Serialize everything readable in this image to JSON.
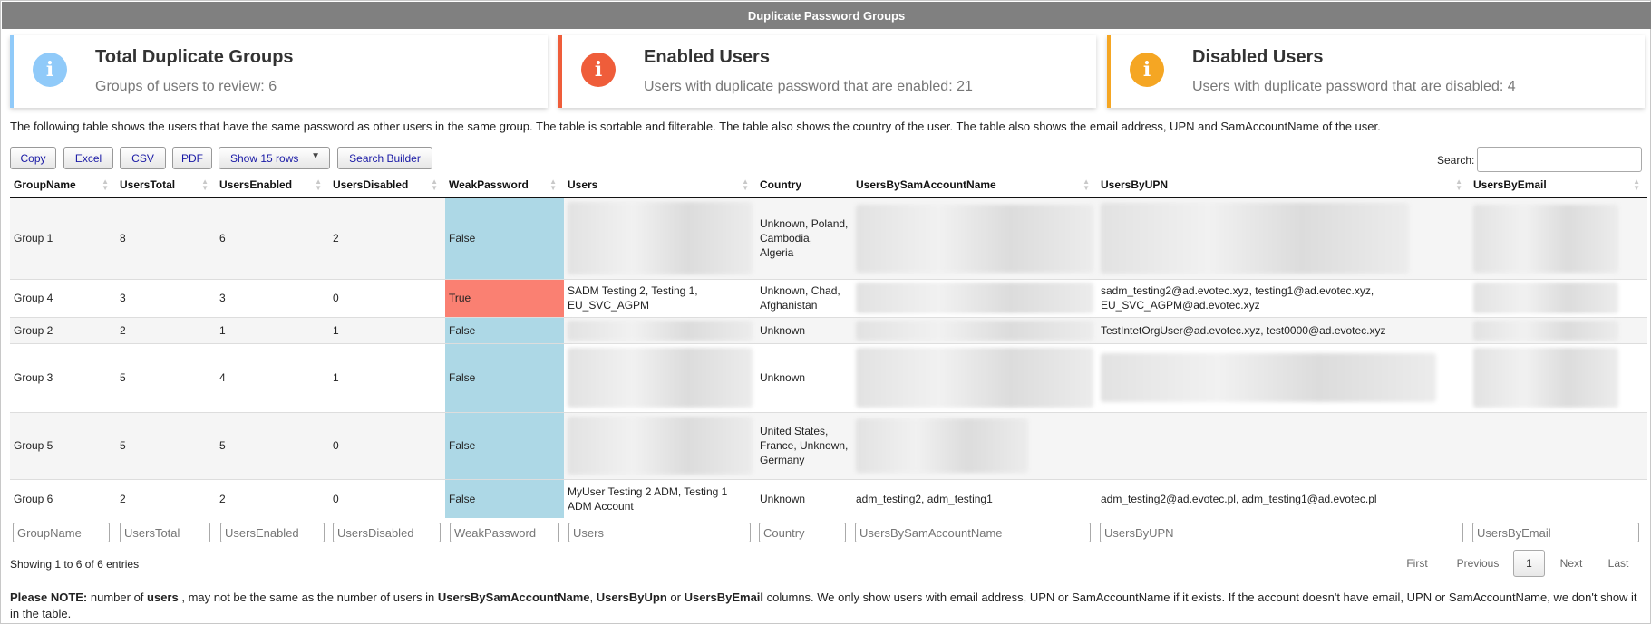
{
  "window": {
    "title": "Duplicate Password Groups"
  },
  "cards": [
    {
      "title": "Total Duplicate Groups",
      "subtitle": "Groups of users to review: 6",
      "icon": "info-icon",
      "color": "#90caf9"
    },
    {
      "title": "Enabled Users",
      "subtitle": "Users with duplicate password that are enabled: 21",
      "icon": "info-icon",
      "color": "#ef5d3a"
    },
    {
      "title": "Disabled Users",
      "subtitle": "Users with duplicate password that are disabled: 4",
      "icon": "info-icon",
      "color": "#f5a623"
    }
  ],
  "description": "The following table shows the users that have the same password as other users in the same group. The table is sortable and filterable. The table also shows the country of the user. The table also shows the email address, UPN and SamAccountName of the user.",
  "toolbar": {
    "copy": "Copy",
    "excel": "Excel",
    "csv": "CSV",
    "pdf": "PDF",
    "show_rows": "Show 15 rows",
    "search_builder": "Search Builder",
    "search_label": "Search:"
  },
  "table": {
    "columns": [
      "GroupName",
      "UsersTotal",
      "UsersEnabled",
      "UsersDisabled",
      "WeakPassword",
      "Users",
      "Country",
      "UsersBySamAccountName",
      "UsersByUPN",
      "UsersByEmail"
    ],
    "rows": [
      {
        "group": "Group 1",
        "total": "8",
        "enabled": "6",
        "disabled": "2",
        "weak": "False",
        "users": "",
        "country": "Unknown, Poland, Cambodia, Algeria",
        "sam": "",
        "upn": "",
        "email": ""
      },
      {
        "group": "Group 4",
        "total": "3",
        "enabled": "3",
        "disabled": "0",
        "weak": "True",
        "users": "SADM Testing 2, Testing 1, EU_SVC_AGPM",
        "country": "Unknown, Chad, Afghanistan",
        "sam": "",
        "upn": "sadm_testing2@ad.evotec.xyz, testing1@ad.evotec.xyz, EU_SVC_AGPM@ad.evotec.xyz",
        "email": ""
      },
      {
        "group": "Group 2",
        "total": "2",
        "enabled": "1",
        "disabled": "1",
        "weak": "False",
        "users": "",
        "country": "Unknown",
        "sam": "",
        "upn": "TestIntetOrgUser@ad.evotec.xyz, test0000@ad.evotec.xyz",
        "email": ""
      },
      {
        "group": "Group 3",
        "total": "5",
        "enabled": "4",
        "disabled": "1",
        "weak": "False",
        "users": "",
        "country": "Unknown",
        "sam": "",
        "upn": "",
        "email": ""
      },
      {
        "group": "Group 5",
        "total": "5",
        "enabled": "5",
        "disabled": "0",
        "weak": "False",
        "users": "",
        "country": "United States, France, Unknown, Germany",
        "sam": "",
        "upn": "",
        "email": ""
      },
      {
        "group": "Group 6",
        "total": "2",
        "enabled": "2",
        "disabled": "0",
        "weak": "False",
        "users": "MyUser Testing 2 ADM, Testing 1 ADM Account",
        "country": "Unknown",
        "sam": "adm_testing2, adm_testing1",
        "upn": "adm_testing2@ad.evotec.pl, adm_testing1@ad.evotec.pl",
        "email": ""
      }
    ],
    "filters": [
      "GroupName",
      "UsersTotal",
      "UsersEnabled",
      "UsersDisabled",
      "WeakPassword",
      "Users",
      "Country",
      "UsersBySamAccountName",
      "UsersByUPN",
      "UsersByEmail"
    ]
  },
  "status": {
    "info": "Showing 1 to 6 of 6 entries"
  },
  "pagination": {
    "first": "First",
    "previous": "Previous",
    "current": "1",
    "next": "Next",
    "last": "Last"
  },
  "note": {
    "label": "Please NOTE:",
    "t1": " number of ",
    "users": "users",
    "t2": " , may not be the same as the number of users in ",
    "sam": "UsersBySamAccountName",
    "t3": ", ",
    "upn": "UsersByUpn",
    "t4": " or ",
    "email": "UsersByEmail",
    "t5": " columns. We only show users with email address, UPN or SamAccountName if it exists. If the account doesn't have email, UPN or SamAccountName, we don't show it in the table."
  },
  "colors": {
    "weak_false": "#add8e6",
    "weak_true": "#fa8072",
    "header_bar": "#808080"
  }
}
